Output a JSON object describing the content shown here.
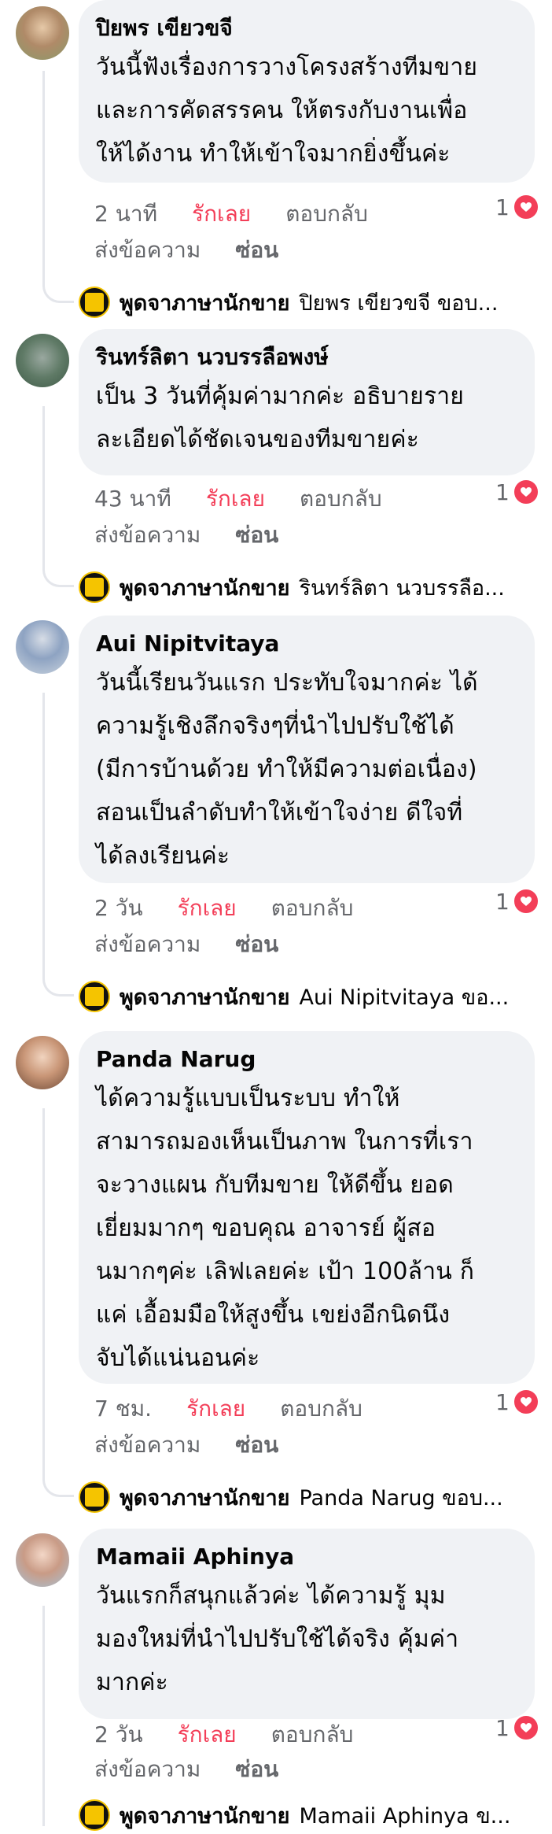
{
  "meta_labels": {
    "love": "รักเลย",
    "reply": "ตอบกลับ",
    "message": "ส่งข้อความ",
    "hide": "ซ่อน"
  },
  "page_name": "พูดจาภาษานักขาย",
  "comments": [
    {
      "author": "ปิยพร เขียวขจี",
      "lines": [
        "วันนี้ฟังเรื่องการวางโครงสร้างทีมขาย",
        "และการคัดสรรคน ให้ตรงกับงานเพื่อ",
        "ให้ได้งาน ทำให้เข้าใจมากยิ่งขึ้นค่ะ"
      ],
      "time": "2 นาที",
      "reaction_count": "1",
      "reply_preview": "ปิยพร เขียวขจี ขอบ..."
    },
    {
      "author": "รินทร์ลิตา นวบรรลือพงษ์",
      "lines": [
        "เป็น 3 วันที่คุ้มค่ามากค่ะ อธิบายราย",
        "ละเอียดได้ชัดเจนของทีมขายค่ะ"
      ],
      "time": "43 นาที",
      "reaction_count": "1",
      "reply_preview": "รินทร์ลิตา นวบรรลือ..."
    },
    {
      "author": "Aui Nipitvitaya",
      "lines": [
        "วันนี้เรียนวันแรก ประทับใจมากค่ะ ได้",
        "ความรู้เชิงลึกจริงๆที่นำไปปรับใช้ได้",
        "(มีการบ้านด้วย ทำให้มีความต่อเนื่อง)",
        "สอนเป็นลำดับทำให้เข้าใจง่าย ดีใจที่",
        "ได้ลงเรียนค่ะ"
      ],
      "time": "2 วัน",
      "reaction_count": "1",
      "reply_preview": "Aui Nipitvitaya ขอ..."
    },
    {
      "author": "Panda Narug",
      "lines": [
        "ได้ความรู้แบบเป็นระบบ ทำให้",
        "สามารถมองเห็นเป็นภาพ ในการที่เรา",
        "จะวางแผน กับทีมขาย ให้ดีขึ้น ยอด",
        "เยี่ยมมากๆ ขอบคุณ อาจารย์ ผู้สอ",
        "นมากๆค่ะ เลิฟเลยค่ะ เป้า 100ล้าน ก็",
        "แค่ เอื้อมมือให้สูงขึ้น เขย่งอีกนิดนึง",
        "จับได้แน่นอนค่ะ"
      ],
      "time": "7 ชม.",
      "reaction_count": "1",
      "reply_preview": "Panda Narug ขอบ..."
    },
    {
      "author": "Mamaii Aphinya",
      "lines": [
        "วันแรกก็สนุกแล้วค่ะ ได้ความรู้ มุม",
        "มองใหม่ที่นำไปปรับใช้ได้จริง คุ้มค่า",
        "มากค่ะ"
      ],
      "time": "2 วัน",
      "reaction_count": "1",
      "reply_preview": "Mamaii Aphinya ข..."
    }
  ]
}
